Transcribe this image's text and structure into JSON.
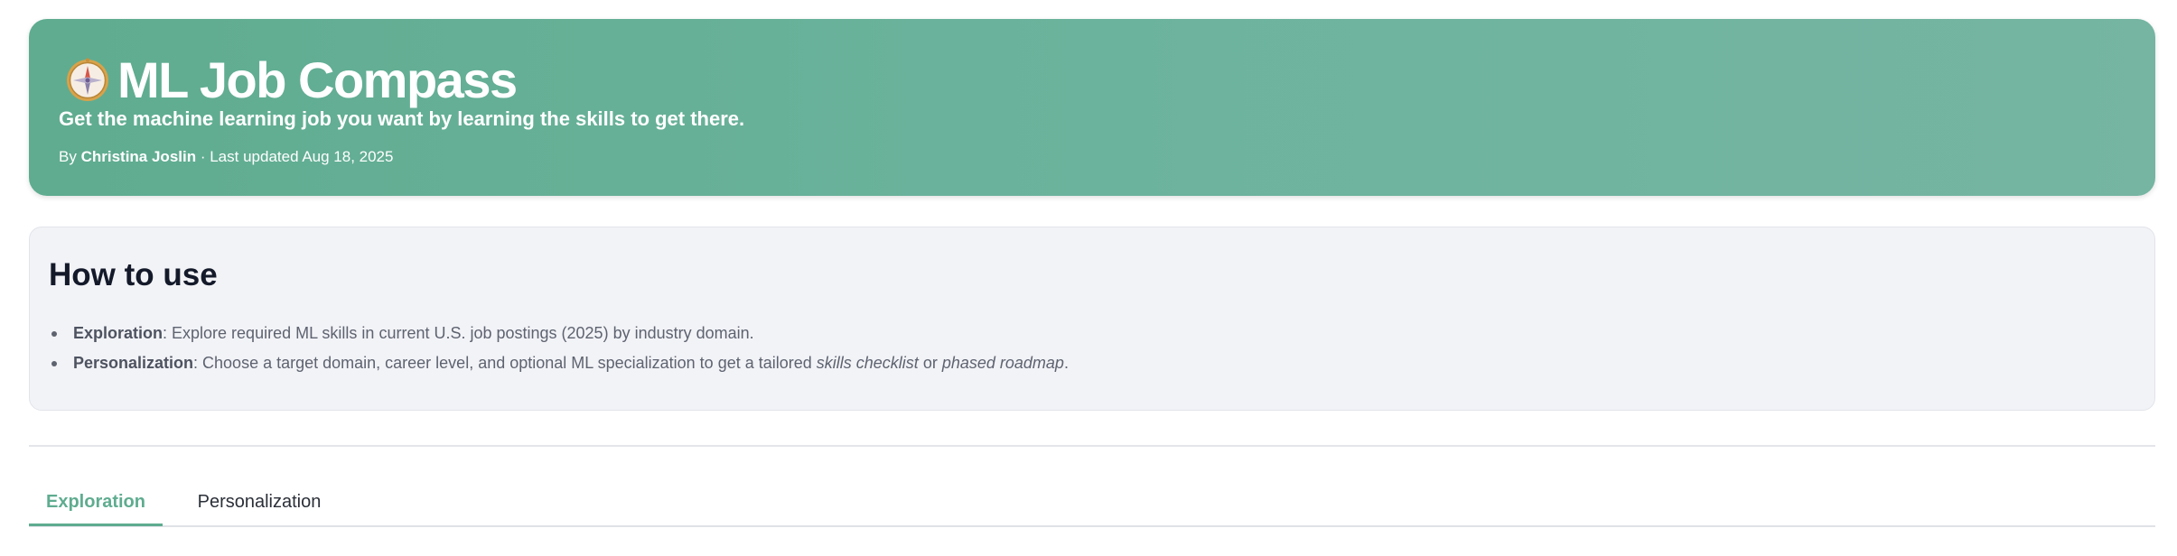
{
  "header": {
    "title": "ML Job Compass",
    "subtitle": "Get the machine learning job you want by learning the skills to get there.",
    "by_label": "By",
    "author": "Christina Joslin",
    "updated": "· Last updated Aug 18, 2025",
    "icon": "compass-icon",
    "colors": {
      "banner_start": "#5fac90",
      "banner_end": "#75b5a2"
    }
  },
  "how_to_use": {
    "title": "How to use",
    "items": [
      {
        "label": "Exploration",
        "text": ": Explore required ML skills in current U.S. job postings (2025) by industry domain."
      },
      {
        "label": "Personalization",
        "text": ": Choose a target domain, career level, and optional ML specialization to get a tailored ",
        "em1": "skills checklist",
        "mid": " or ",
        "em2": "phased roadmap",
        "end": "."
      }
    ]
  },
  "tabs": [
    {
      "label": "Exploration",
      "active": true
    },
    {
      "label": "Personalization",
      "active": false
    }
  ],
  "colors": {
    "accent": "#5fac90",
    "card_bg": "#f2f3f7",
    "title_text": "#141a2a",
    "body_text": "#5e6370"
  }
}
